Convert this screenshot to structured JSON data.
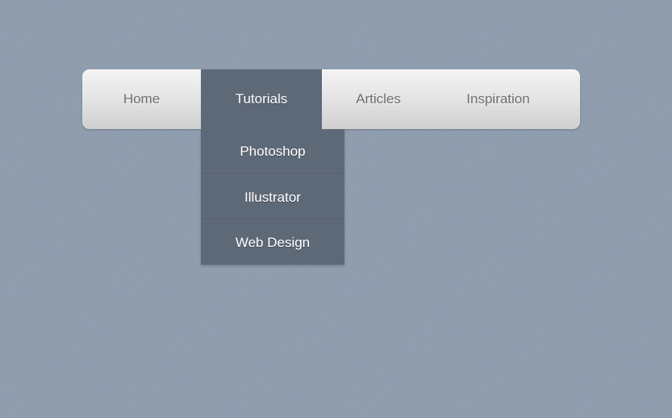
{
  "nav": {
    "items": [
      {
        "label": "Home",
        "active": false
      },
      {
        "label": "Tutorials",
        "active": true
      },
      {
        "label": "Articles",
        "active": false
      },
      {
        "label": "Inspiration",
        "active": false
      }
    ]
  },
  "dropdown": {
    "parent": "Tutorials",
    "items": [
      {
        "label": "Photoshop"
      },
      {
        "label": "Illustrator"
      },
      {
        "label": "Web Design"
      }
    ]
  },
  "colors": {
    "background": "#8f9eaf",
    "active_item": "#5e6978",
    "inactive_text": "#6e6e6e",
    "active_text": "#ffffff"
  }
}
